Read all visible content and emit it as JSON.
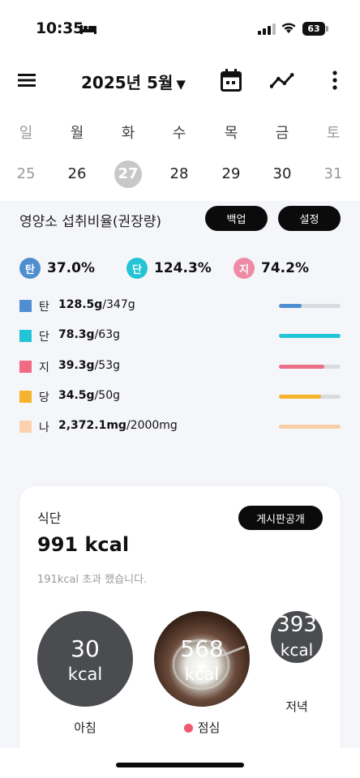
{
  "status": {
    "time": "10:35",
    "battery": "63"
  },
  "header": {
    "month_title": "2025년 5월",
    "dropdown_arrow": "▼"
  },
  "week": {
    "days": [
      "일",
      "월",
      "화",
      "수",
      "목",
      "금",
      "토"
    ],
    "dates": [
      "25",
      "26",
      "27",
      "28",
      "29",
      "30",
      "31"
    ],
    "selected_date": "27"
  },
  "summary": {
    "title": "영양소 섭취비율(권장량)",
    "backup_label": "백업",
    "settings_label": "설정",
    "ratios": [
      {
        "badge": "탄",
        "percent": "37.0%",
        "color": "#4f8fd1"
      },
      {
        "badge": "단",
        "percent": "124.3%",
        "color": "#22c4d6"
      },
      {
        "badge": "지",
        "percent": "74.2%",
        "color": "#ee8aa5"
      }
    ],
    "nutrients": [
      {
        "label": "탄",
        "amount": "128.5g",
        "target": "/347g",
        "color": "#4f8fd1",
        "bar_color": "#4f8fd1",
        "progress": 0.37
      },
      {
        "label": "단",
        "amount": "78.3g",
        "target": "/63g",
        "color": "#22c4d6",
        "bar_color": "#22c4d6",
        "progress": 1.0
      },
      {
        "label": "지",
        "amount": "39.3g",
        "target": "/53g",
        "color": "#f06b84",
        "bar_color": "#ec6f87",
        "progress": 0.742
      },
      {
        "label": "당",
        "amount": "34.5g",
        "target": "/50g",
        "color": "#f6b42e",
        "bar_color": "#f6b42e",
        "progress": 0.69
      },
      {
        "label": "나",
        "amount": "2,372.1mg",
        "target": "/2000mg",
        "color": "#fcd1ad",
        "bar_color": "#f7cda6",
        "progress": 1.0
      }
    ]
  },
  "meals": {
    "title": "식단",
    "total": "991 kcal",
    "note": "191kcal 초과 했습니다.",
    "publish_label": "게시판공개",
    "items": [
      {
        "kcal": "30",
        "unit": "kcal",
        "label": "아침",
        "has_photo": false,
        "marked": false
      },
      {
        "kcal": "568",
        "unit": "kcal",
        "label": "점심",
        "has_photo": true,
        "marked": true
      },
      {
        "kcal": "393",
        "unit": "kcal",
        "label": "저녁",
        "has_photo": false,
        "marked": false
      }
    ]
  }
}
